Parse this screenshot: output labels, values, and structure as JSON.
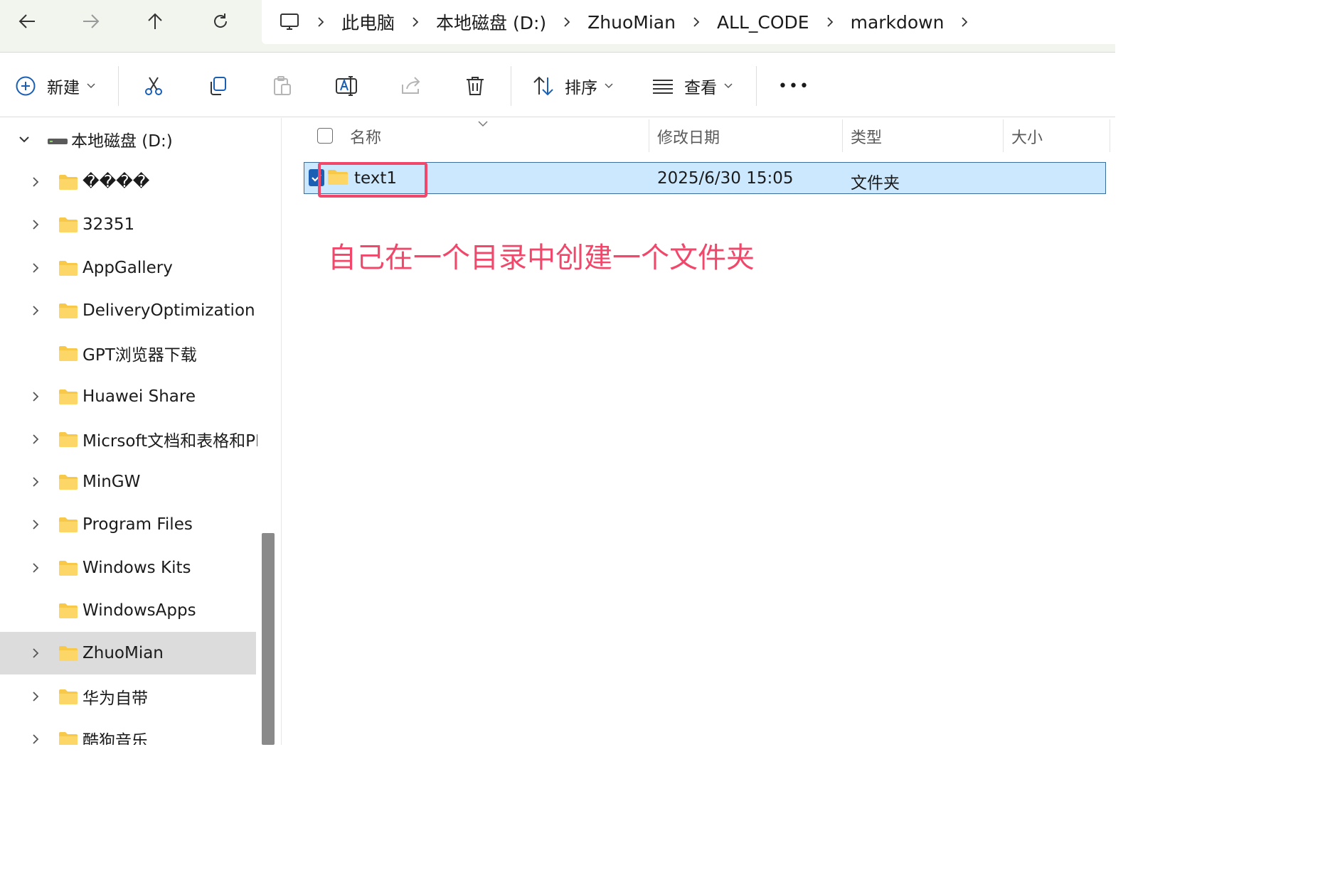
{
  "address_bar": {
    "nav_icons": [
      "back-arrow-icon",
      "forward-arrow-icon",
      "up-arrow-icon",
      "refresh-icon"
    ],
    "breadcrumbs": [
      "此电脑",
      "本地磁盘 (D:)",
      "ZhuoMian",
      "ALL_CODE",
      "markdown"
    ]
  },
  "toolbar": {
    "new_label": "新建",
    "sort_label": "排序",
    "view_label": "查看",
    "more_label": "•••",
    "icons": [
      "add-circle-icon",
      "cut-icon",
      "copy-icon",
      "paste-icon",
      "rename-icon",
      "share-icon",
      "delete-icon",
      "sort-icon",
      "view-icon",
      "more-icon"
    ]
  },
  "nav_pane": {
    "root": "本地磁盘 (D:)",
    "items": [
      {
        "name": "����",
        "expandable": true
      },
      {
        "name": "32351",
        "expandable": true
      },
      {
        "name": "AppGallery",
        "expandable": true
      },
      {
        "name": "DeliveryOptimization",
        "expandable": true
      },
      {
        "name": "GPT浏览器下载",
        "expandable": false
      },
      {
        "name": "Huawei Share",
        "expandable": true
      },
      {
        "name": "Micrsoft文档和表格和PPT",
        "expandable": true
      },
      {
        "name": "MinGW",
        "expandable": true
      },
      {
        "name": "Program Files",
        "expandable": true
      },
      {
        "name": "Windows Kits",
        "expandable": true
      },
      {
        "name": "WindowsApps",
        "expandable": false
      },
      {
        "name": "ZhuoMian",
        "expandable": true,
        "selected": true
      },
      {
        "name": "华为自带",
        "expandable": true
      },
      {
        "name": "酷狗音乐",
        "expandable": true
      }
    ]
  },
  "columns": {
    "name": "名称",
    "modified": "修改日期",
    "type": "类型",
    "size": "大小"
  },
  "files": [
    {
      "name": "text1",
      "modified": "2025/6/30 15:05",
      "type": "文件夹",
      "size": "",
      "selected": true,
      "checked": true
    }
  ],
  "annotation": {
    "text": "自己在一个目录中创建一个文件夹",
    "color": "#f0476a"
  },
  "colors": {
    "selection_bg": "#cce8ff",
    "folder_yellow": "#f8c948",
    "accent_blue": "#1a5fb4",
    "annotation_red": "#f0476a"
  }
}
